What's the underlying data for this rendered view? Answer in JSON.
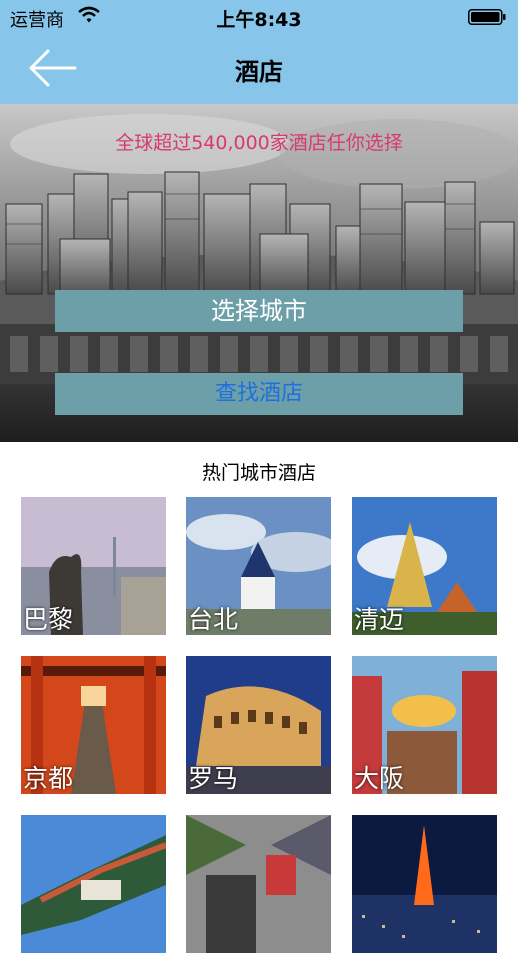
{
  "status_bar": {
    "carrier": "运营商",
    "time": "上午8:43"
  },
  "nav": {
    "title": "酒店",
    "back_icon": "arrow-left-icon"
  },
  "hero": {
    "tagline": "全球超过540,000家酒店任你选择",
    "select_city_label": "选择城市",
    "find_hotel_label": "查找酒店"
  },
  "section": {
    "title": "热门城市酒店"
  },
  "cities": [
    {
      "name": "巴黎"
    },
    {
      "name": "台北"
    },
    {
      "name": "清迈"
    },
    {
      "name": "京都"
    },
    {
      "name": "罗马"
    },
    {
      "name": "大阪"
    },
    {
      "name": ""
    },
    {
      "name": ""
    },
    {
      "name": ""
    }
  ],
  "colors": {
    "nav_bg": "#87c6ea",
    "button_bg": "#6d9fa9",
    "tagline": "#d83a6c",
    "find_hotel_text": "#1f6fe0"
  }
}
